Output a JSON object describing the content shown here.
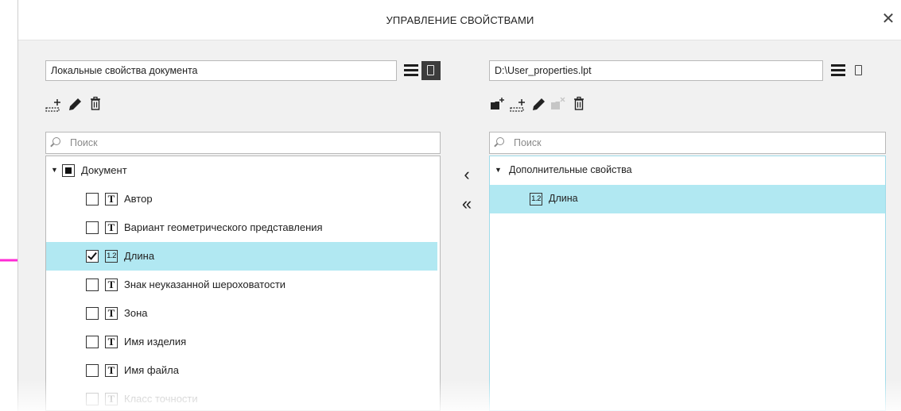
{
  "window": {
    "title": "УПРАВЛЕНИЕ СВОЙСТВАМИ",
    "close_glyph": "✕"
  },
  "left_panel": {
    "source_value": "Локальные свойства документа",
    "search_placeholder": "Поиск",
    "toolbar_icons": [
      "add-property-icon",
      "edit-pencil-icon",
      "trash-icon"
    ],
    "root": {
      "label": "Документ",
      "expanded": true
    },
    "items": [
      {
        "label": "Автор",
        "type": "text",
        "type_glyph": "T",
        "checked": false,
        "selected": false
      },
      {
        "label": "Вариант геометрического представления",
        "type": "text",
        "type_glyph": "T",
        "checked": false,
        "selected": false
      },
      {
        "label": "Длина",
        "type": "number",
        "type_glyph": "1.2",
        "checked": true,
        "selected": true
      },
      {
        "label": "Знак неуказанной шероховатости",
        "type": "text",
        "type_glyph": "T",
        "checked": false,
        "selected": false
      },
      {
        "label": "Зона",
        "type": "text",
        "type_glyph": "T",
        "checked": false,
        "selected": false
      },
      {
        "label": "Имя изделия",
        "type": "text",
        "type_glyph": "T",
        "checked": false,
        "selected": false
      },
      {
        "label": "Имя файла",
        "type": "text",
        "type_glyph": "T",
        "checked": false,
        "selected": false
      },
      {
        "label": "Класс точности",
        "type": "text",
        "type_glyph": "T",
        "checked": false,
        "selected": false
      }
    ]
  },
  "middle": {
    "move_one": "‹",
    "move_all": "«"
  },
  "right_panel": {
    "source_value": "D:\\User_properties.lpt",
    "search_placeholder": "Поиск",
    "toolbar_icons": [
      "add-folder-icon",
      "add-property-icon",
      "edit-pencil-icon",
      "remove-folder-icon",
      "trash-icon"
    ],
    "group": {
      "label": "Дополнительные свойства",
      "expanded": true
    },
    "items": [
      {
        "label": "Длина",
        "type": "number",
        "type_glyph": "1.2",
        "selected": true
      }
    ]
  },
  "colors": {
    "selection": "#b1e8f2",
    "annotation_arrow": "#ff2bd5",
    "panel_bg": "#f1f1f1"
  }
}
